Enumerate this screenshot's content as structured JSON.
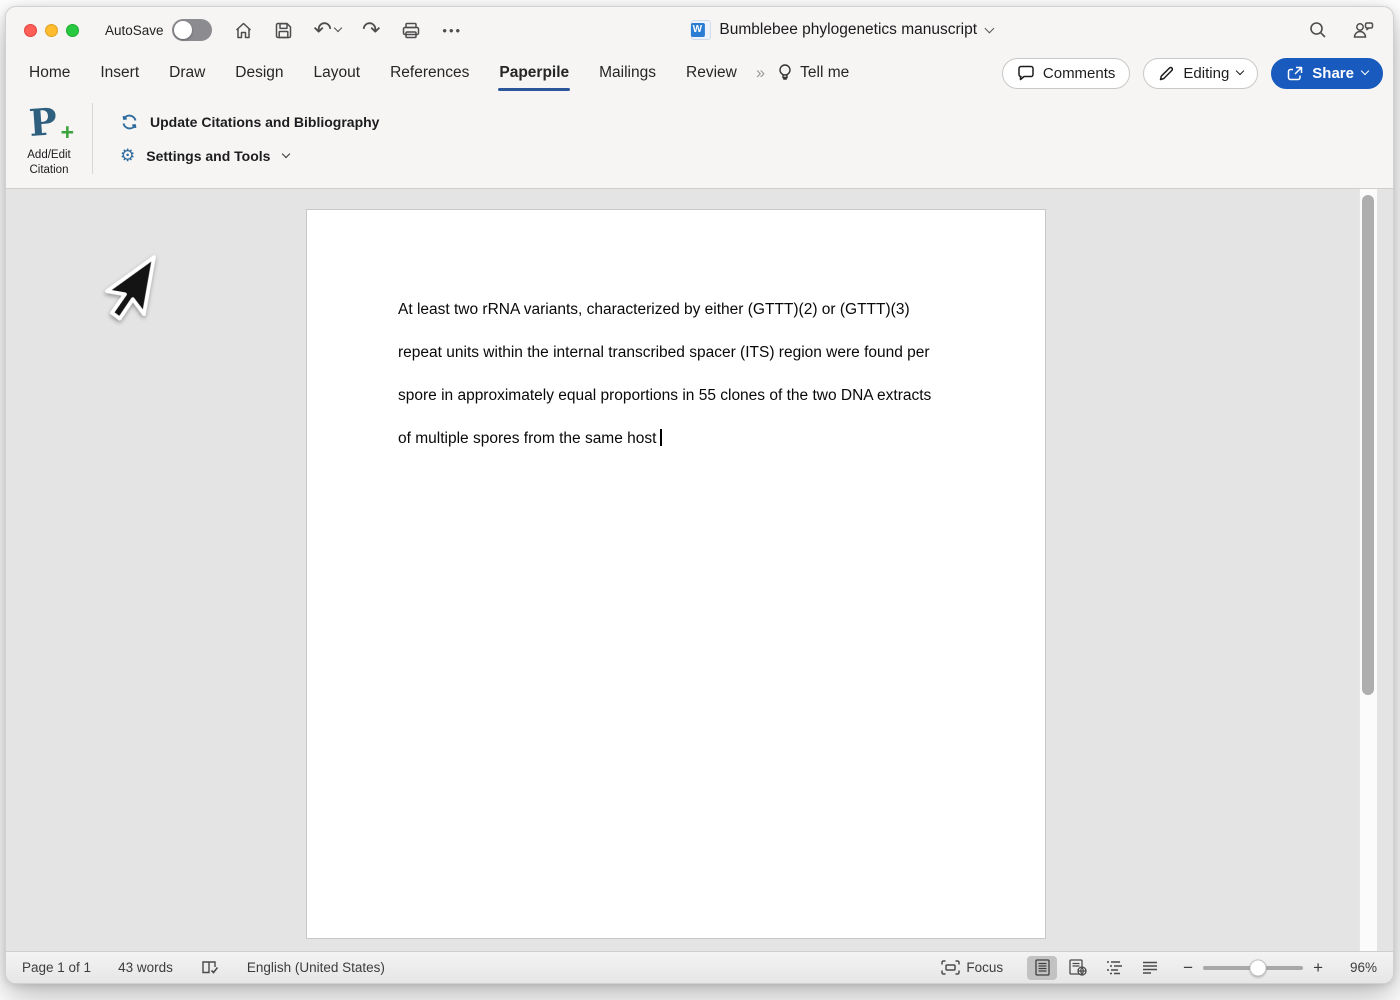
{
  "titlebar": {
    "autosave_label": "AutoSave",
    "autosave_state": "off",
    "document_title": "Bumblebee phylogenetics manuscript",
    "doc_icon_letter": "W"
  },
  "tabs": {
    "items": [
      "Home",
      "Insert",
      "Draw",
      "Design",
      "Layout",
      "References",
      "Paperpile",
      "Mailings",
      "Review"
    ],
    "active_tab": "Paperpile",
    "overflow_glyph": "››",
    "tell_me_label": "Tell me"
  },
  "topbar_buttons": {
    "comments_label": "Comments",
    "editing_label": "Editing",
    "share_label": "Share"
  },
  "ribbon": {
    "paperpile_logo_letter": "P",
    "paperpile_logo_plus": "+",
    "add_edit_citation_line1": "Add/Edit",
    "add_edit_citation_line2": "Citation",
    "update_citations_label": "Update Citations and Bibliography",
    "settings_tools_label": "Settings and Tools"
  },
  "document": {
    "lines": [
      "At least two rRNA variants, characterized by either (GTTT)(2) or (GTTT)(3)",
      "repeat units within the internal transcribed spacer (ITS) region were found per",
      "spore in approximately equal proportions in 55 clones of the two DNA extracts",
      "of multiple spores from the same host"
    ]
  },
  "statusbar": {
    "page_indicator": "Page 1 of 1",
    "word_count": "43 words",
    "language": "English (United States)",
    "focus_label": "Focus",
    "zoom_minus": "−",
    "zoom_plus": "+",
    "zoom_level": "96%"
  },
  "icons": {
    "undo": "↶",
    "redo": "↷",
    "more": "•••",
    "gear": "⚙",
    "home": "svg-house",
    "save": "svg-floppy",
    "print": "svg-printer",
    "search": "svg-magnifier",
    "account": "svg-person-bubble",
    "lightbulb": "svg-bulb",
    "comments": "svg-speech-bubble",
    "editing": "svg-pencil",
    "share": "svg-box-arrow",
    "sync": "svg-refresh-arrows",
    "proofing": "svg-book-check",
    "focus": "svg-corner-brackets",
    "print-layout": "svg-page-lines",
    "web-layout": "svg-page-globe",
    "outline-view": "svg-indent-list",
    "draft-view": "svg-rule-lines",
    "chevron-down": "css-chevron"
  },
  "colors": {
    "accent_blue": "#185abd",
    "tab_underline": "#2b579a",
    "paperpile_blue": "#2e5f7e",
    "paperpile_green": "#3da33c",
    "tool_icon_blue": "#2e6b9e",
    "canvas_gray": "#e5e4e4"
  }
}
